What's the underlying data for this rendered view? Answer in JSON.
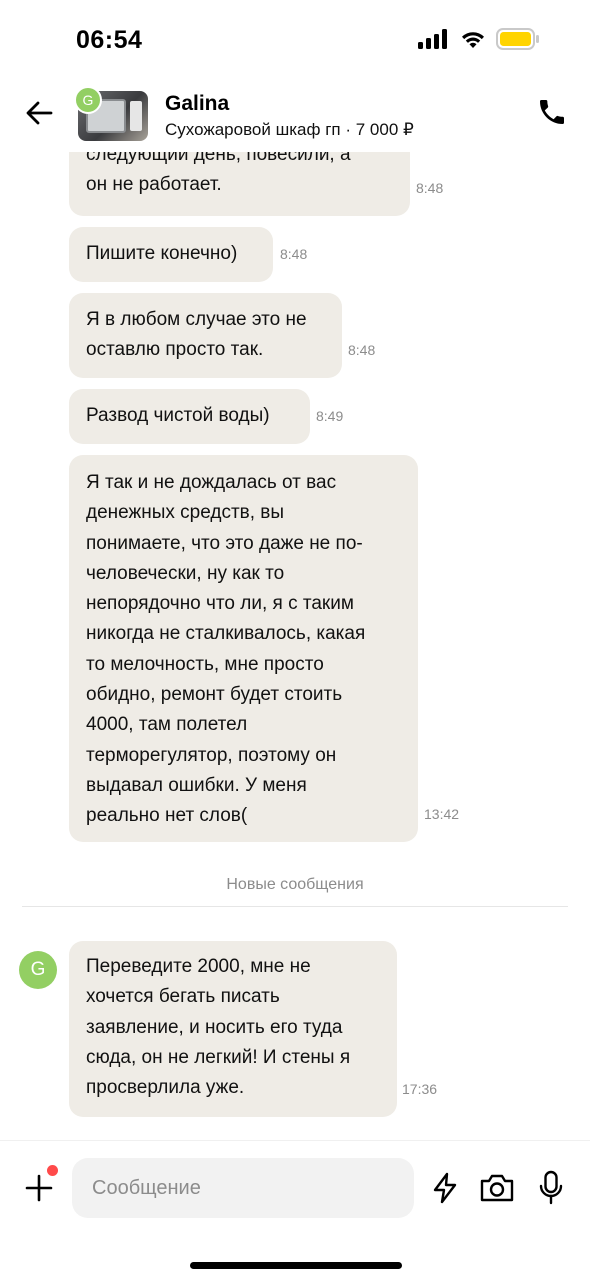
{
  "status": {
    "time": "06:54"
  },
  "header": {
    "contact_name": "Galina",
    "avatar_initial": "G",
    "listing": "Сухожаровой шкаф гп · 7 000 ₽",
    "icons": {
      "back": "arrow-left-icon",
      "call": "phone-icon"
    }
  },
  "messages": [
    {
      "lines": [
        "следующий день, повесили, а",
        "он не работает."
      ],
      "time": "8:48"
    },
    {
      "lines": [
        "Пишите конечно)"
      ],
      "time": "8:48"
    },
    {
      "lines": [
        "Я в любом случае это не",
        "оставлю просто так."
      ],
      "time": "8:48"
    },
    {
      "lines": [
        "Развод чистой воды)"
      ],
      "time": "8:49"
    },
    {
      "lines": [
        "Я так и не дождалась от вас",
        "денежных средств, вы",
        "понимаете, что это даже не по-",
        "человечески, ну как то",
        "непорядочно что ли, я с таким",
        "никогда не сталкивалось, какая",
        "то мелочность, мне просто",
        "обидно, ремонт будет стоить",
        "4000, там полетел",
        "терморегулятор, поэтому он",
        "выдавал ошибки. У меня",
        "реально нет слов("
      ],
      "time": "13:42"
    }
  ],
  "new_messages_label": "Новые сообщения",
  "new_message": {
    "avatar_initial": "G",
    "lines": [
      "Переведите 2000, мне не",
      "хочется бегать писать",
      "заявление, и носить его туда",
      "сюда, он не легкий! И стены я",
      "просверлила уже."
    ],
    "time": "17:36"
  },
  "composer": {
    "placeholder": "Сообщение",
    "icons": {
      "attach": "plus-icon",
      "quick": "lightning-icon",
      "camera": "camera-icon",
      "mic": "microphone-icon"
    },
    "colors": {
      "notification_dot": "#ff4a4a"
    }
  },
  "colors": {
    "bubble": "#efece6",
    "avatar": "#93cf63",
    "timestamp": "#8c8c8c",
    "battery": "#ffd400"
  }
}
